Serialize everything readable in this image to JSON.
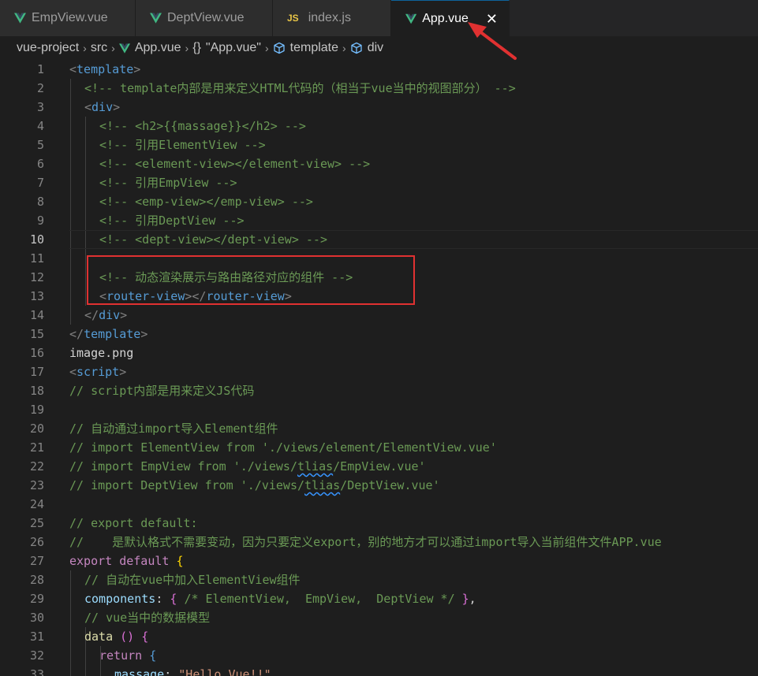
{
  "tabs": [
    {
      "label": "EmpView.vue",
      "icon": "vue-icon",
      "active": false
    },
    {
      "label": "DeptView.vue",
      "icon": "vue-icon",
      "active": false
    },
    {
      "label": "index.js",
      "icon": "js-icon",
      "icon_text": "JS",
      "active": false
    },
    {
      "label": "App.vue",
      "icon": "vue-icon",
      "active": true,
      "close": "✕"
    }
  ],
  "breadcrumb": {
    "items": [
      "vue-project",
      "src",
      "App.vue",
      "\"App.vue\"",
      "template",
      "div"
    ],
    "separator": "›",
    "braces": "{}"
  },
  "editor": {
    "current_line": 10,
    "lines": [
      {
        "n": "1"
      },
      {
        "n": "2"
      },
      {
        "n": "3"
      },
      {
        "n": "4"
      },
      {
        "n": "5"
      },
      {
        "n": "6"
      },
      {
        "n": "7"
      },
      {
        "n": "8"
      },
      {
        "n": "9"
      },
      {
        "n": "10"
      },
      {
        "n": "11"
      },
      {
        "n": "12"
      },
      {
        "n": "13"
      },
      {
        "n": "14"
      },
      {
        "n": "15"
      },
      {
        "n": "16"
      },
      {
        "n": "17"
      },
      {
        "n": "18"
      },
      {
        "n": "19"
      },
      {
        "n": "20"
      },
      {
        "n": "21"
      },
      {
        "n": "22"
      },
      {
        "n": "23"
      },
      {
        "n": "24"
      },
      {
        "n": "25"
      },
      {
        "n": "26"
      },
      {
        "n": "27"
      },
      {
        "n": "28"
      },
      {
        "n": "29"
      },
      {
        "n": "30"
      },
      {
        "n": "31"
      },
      {
        "n": "32"
      },
      {
        "n": "33"
      }
    ],
    "code": {
      "l2": "<!-- template内部是用来定义HTML代码的（相当于vue当中的视图部分） -->",
      "l4": "<!-- <h2>{{massage}}</h2> -->",
      "l5": "<!-- 引用ElementView -->",
      "l6": "<!-- <element-view></element-view> -->",
      "l7": "<!-- 引用EmpView -->",
      "l8": "<!-- <emp-view></emp-view> -->",
      "l9": "<!-- 引用DeptView -->",
      "l10": "<!-- <dept-view></dept-view> -->",
      "l12": "<!-- 动态渲染展示与路由路径对应的组件 -->",
      "l16": "image.png",
      "l18": "// script内部是用来定义JS代码",
      "l20": "// 自动通过import导入Element组件",
      "l21": "// import ElementView from './views/element/ElementView.vue'",
      "l22a": "// import EmpView from './views/",
      "l22b": "tlias",
      "l22c": "/EmpView.vue'",
      "l23a": "// import DeptView from './views/",
      "l23b": "tlias",
      "l23c": "/DeptView.vue'",
      "l25": "// export default:",
      "l26": "//    是默认格式不需要变动，因为只要定义export，别的地方才可以通过import导入当前组件文件APP.vue",
      "l28": "// 自动在vue中加入ElementView组件",
      "l29_comment": "/* ElementView,  EmpView,  DeptView */",
      "l30": "// vue当中的数据模型",
      "l33_string": "\"Hello Vue!!\""
    }
  },
  "colors": {
    "background": "#1e1e1e",
    "comment": "#6a9955",
    "tag": "#569cd6",
    "keyword": "#c586c0",
    "string": "#ce9178",
    "annotation_red": "#e03131",
    "vue_green": "#41b883"
  }
}
